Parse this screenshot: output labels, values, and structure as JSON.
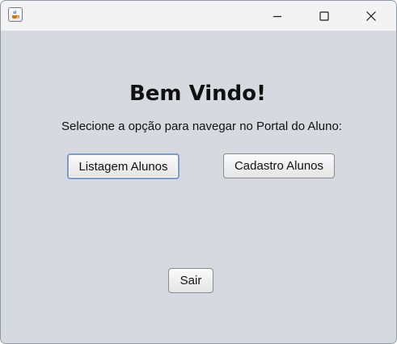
{
  "window": {
    "title": "",
    "app_icon": "java-coffee-cup-icon",
    "controls": {
      "minimize_icon": "minimize-icon",
      "maximize_icon": "maximize-icon",
      "close_icon": "close-icon"
    }
  },
  "main": {
    "heading": "Bem Vindo!",
    "subtitle": "Selecione a opção para navegar no Portal do Aluno:",
    "buttons": {
      "listagem_label": "Listagem Alunos",
      "cadastro_label": "Cadastro Alunos",
      "sair_label": "Sair"
    }
  },
  "colors": {
    "background": "#d6d9e0",
    "titlebar": "#f3f3f3",
    "focus_border": "#7b9cc4"
  }
}
